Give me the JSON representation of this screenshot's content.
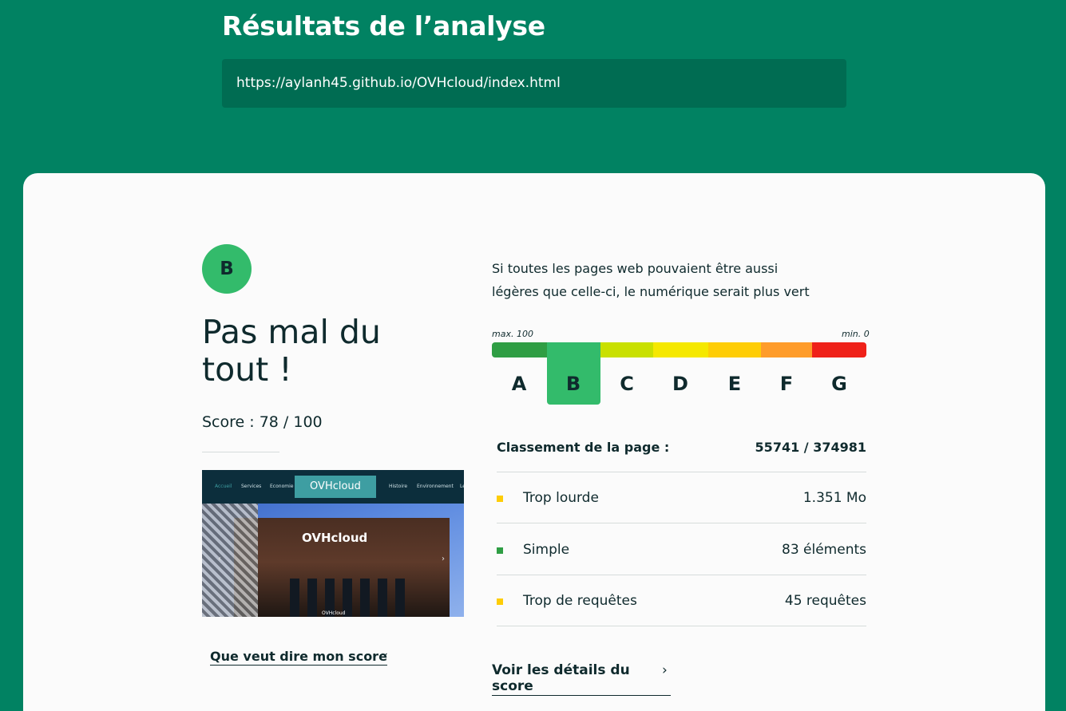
{
  "header": {
    "title": "Résultats de l’analyse",
    "url": "https://aylanh45.github.io/OVHcloud/index.html"
  },
  "summary": {
    "grade": "B",
    "verdict": "Pas mal du tout !",
    "score": "Score : 78 / 100",
    "score_link": "Que veut dire mon score",
    "chevron_down_glyph": "⌄"
  },
  "thumbnail": {
    "nav_items": [
      "Accueil",
      "Services",
      "Economie",
      "Histoire",
      "Environnement",
      "Le"
    ],
    "logo_text": "OVHcloud",
    "building_sign": "OVHcloud",
    "caption": "OVHcloud",
    "arrow_left": "‹",
    "arrow_right": "›"
  },
  "analysis": {
    "intro": "Si toutes les pages web pouvaient être aussi légères que celle-ci, le numérique serait plus vert",
    "scale_max_label": "max. 100",
    "scale_min_label": "min. 0",
    "grades": [
      {
        "letter": "A",
        "color": "#2f9e44"
      },
      {
        "letter": "B",
        "color": "#33bb6b"
      },
      {
        "letter": "C",
        "color": "#c9e000"
      },
      {
        "letter": "D",
        "color": "#f5e800"
      },
      {
        "letter": "E",
        "color": "#fecd06"
      },
      {
        "letter": "F",
        "color": "#fe9c2a"
      },
      {
        "letter": "G",
        "color": "#ef2119"
      }
    ],
    "selected_grade": "B",
    "rank_label": "Classement de la page :",
    "rank_value": "55741 / 374981",
    "metrics": [
      {
        "name": "Trop lourde",
        "value": "1.351 Mo",
        "status_color": "#fecd06"
      },
      {
        "name": "Simple",
        "value": "83 éléments",
        "status_color": "#2f9e44"
      },
      {
        "name": "Trop de requêtes",
        "value": "45 requêtes",
        "status_color": "#fecd06"
      }
    ],
    "details_link": "Voir les détails du score",
    "chevron_right_glyph": "›"
  }
}
